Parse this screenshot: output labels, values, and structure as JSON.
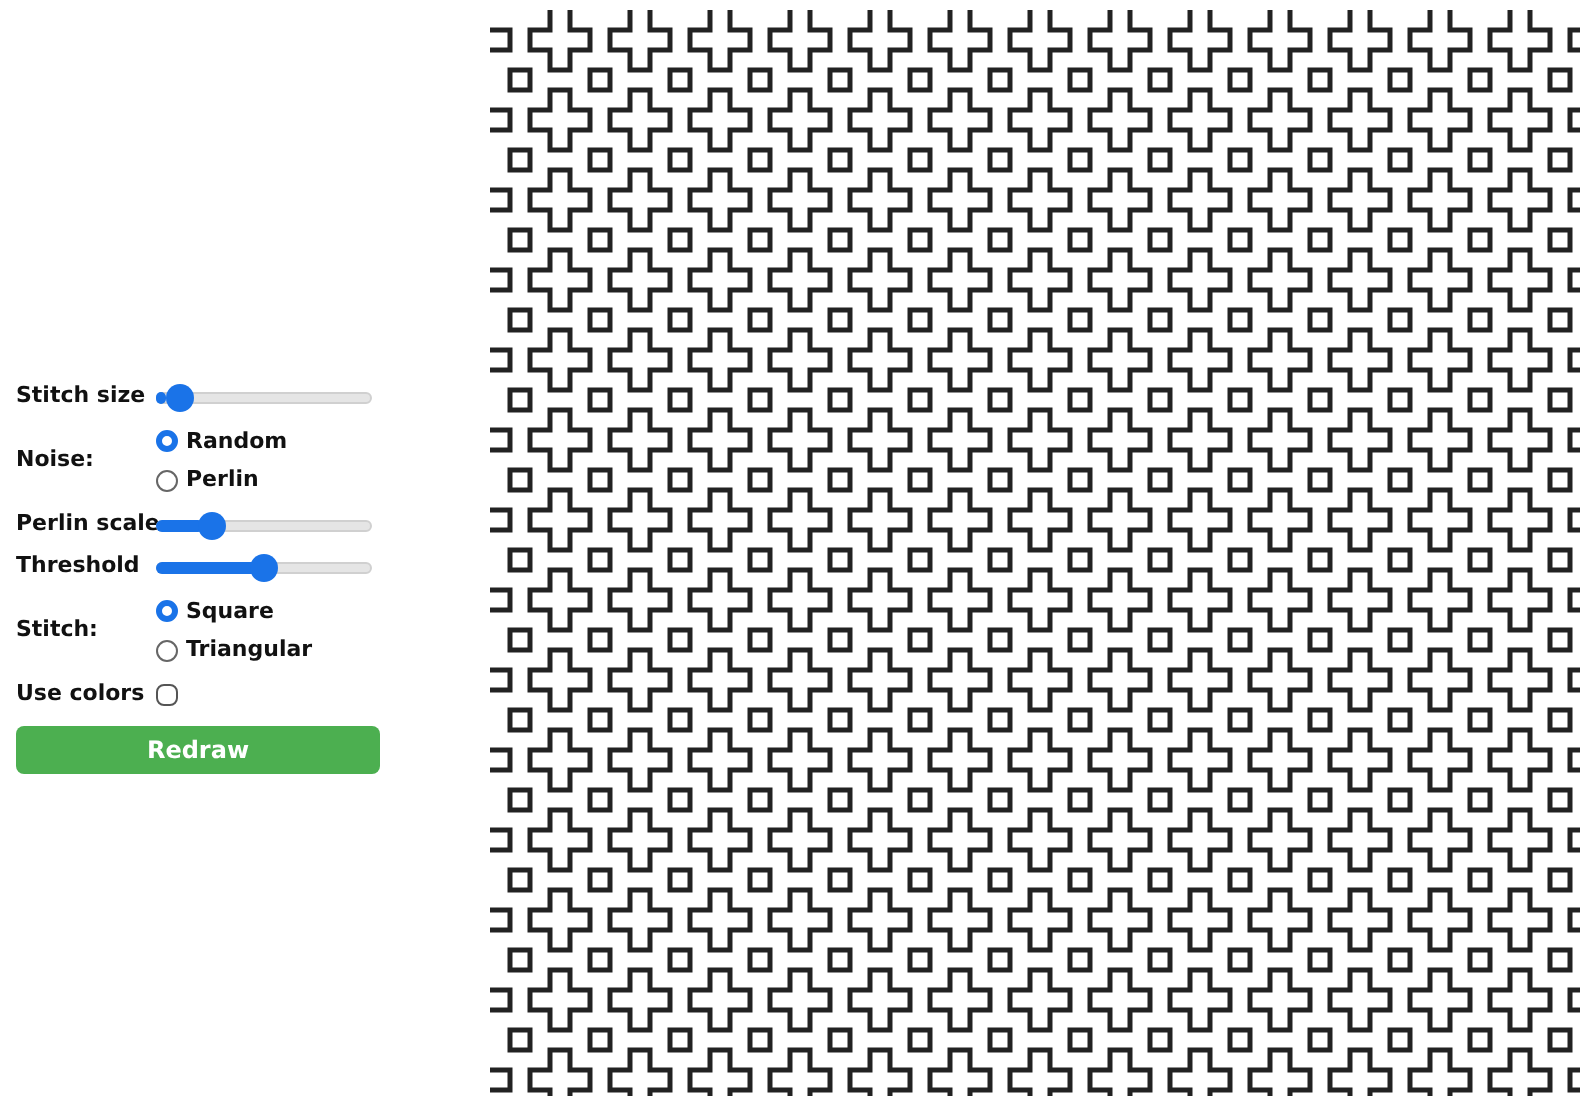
{
  "controls": [
    {
      "kind": "slider",
      "label": "Stitch size",
      "level": 0.05
    },
    {
      "kind": "radio",
      "label": "Noise:",
      "options": [
        {
          "label": "Random",
          "selected": true
        },
        {
          "label": "Perlin",
          "selected": false
        }
      ]
    },
    {
      "kind": "slider",
      "label": "Perlin scale",
      "level": 0.22
    },
    {
      "kind": "slider",
      "label": "Threshold",
      "level": 0.5
    },
    {
      "kind": "radio",
      "label": "Stitch:",
      "options": [
        {
          "label": "Square",
          "selected": true
        },
        {
          "label": "Triangular",
          "selected": false
        }
      ]
    },
    {
      "kind": "checkbox",
      "label": "Use colors",
      "checked": false
    }
  ],
  "button": "Redraw"
}
